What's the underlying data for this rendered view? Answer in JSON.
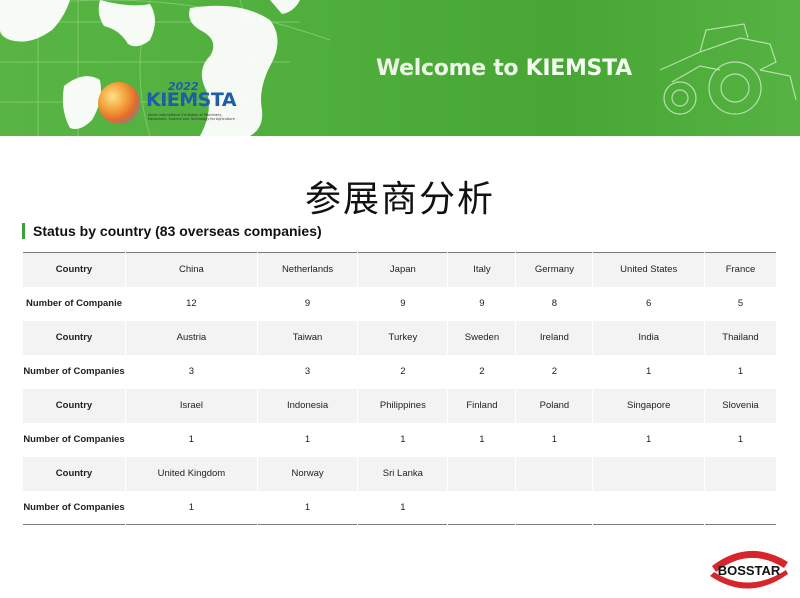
{
  "banner": {
    "welcome_lead": "Welcome to ",
    "welcome_brand": "KIEMSTA",
    "logo_year": "2022",
    "logo_name": "KIEMSTA",
    "logo_sub": "Korea International Exhibition of Machinery, Equipment, Science and Technology for Agriculture"
  },
  "page_title": "参展商分析",
  "section_title": "Status by country (83 overseas companies)",
  "table": {
    "rows": [
      {
        "label": "Country",
        "cells": [
          "China",
          "Netherlands",
          "Japan",
          "Italy",
          "Germany",
          "United States",
          "France"
        ]
      },
      {
        "label": "Number of Companie",
        "cells": [
          "12",
          "9",
          "9",
          "9",
          "8",
          "6",
          "5"
        ]
      },
      {
        "label": "Country",
        "cells": [
          "Austria",
          "Taiwan",
          "Turkey",
          "Sweden",
          "Ireland",
          "India",
          "Thailand"
        ]
      },
      {
        "label": "Number of Companies",
        "cells": [
          "3",
          "3",
          "2",
          "2",
          "2",
          "1",
          "1"
        ]
      },
      {
        "label": "Country",
        "cells": [
          "Israel",
          "Indonesia",
          "Philippines",
          "Finland",
          "Poland",
          "Singapore",
          "Slovenia"
        ]
      },
      {
        "label": "Number of Companies",
        "cells": [
          "1",
          "1",
          "1",
          "1",
          "1",
          "1",
          "1"
        ]
      },
      {
        "label": "Country",
        "cells": [
          "United Kingdom",
          "Norway",
          "Sri Lanka",
          "",
          "",
          "",
          ""
        ]
      },
      {
        "label": "Number of Companies",
        "cells": [
          "1",
          "1",
          "1",
          "",
          "",
          "",
          ""
        ]
      }
    ]
  },
  "footer_logo": {
    "text": "BOSSTAR",
    "accent": "#d6262b"
  }
}
